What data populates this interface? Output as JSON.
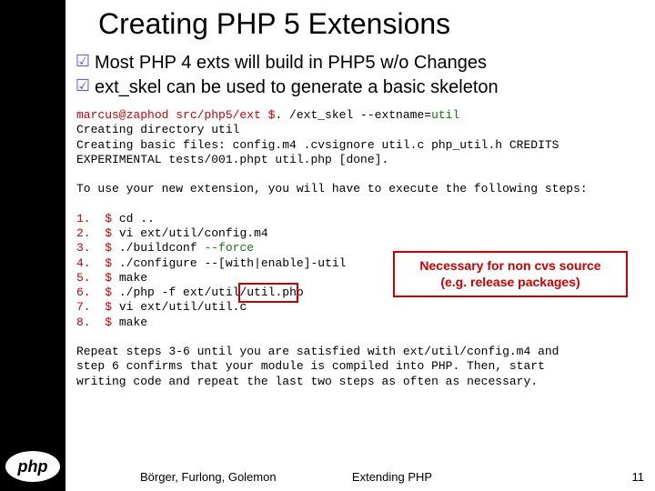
{
  "title": "Creating PHP 5 Extensions",
  "bullets": [
    "Most PHP 4 exts will build in PHP5 w/o Changes",
    "ext_skel can be used to generate a basic skeleton"
  ],
  "code1_prefix": "marcus@zaphod src/php5/ext $",
  "code1_cmd": ". /ext_skel --extname=",
  "code1_arg": "util",
  "code2": "Creating directory util\nCreating basic files: config.m4 .cvsignore util.c php_util.h CREDITS\nEXPERIMENTAL tests/001.phpt util.php [done].",
  "code3": "To use your new extension, you will have to execute the following steps:",
  "steps_nums": [
    "1.",
    "2.",
    "3.",
    "4.",
    "5.",
    "6.",
    "7.",
    "8."
  ],
  "steps_ps": [
    "$",
    "$",
    "$",
    "$",
    "$",
    "$",
    "$",
    "$"
  ],
  "steps_cmds": [
    "cd ..",
    "vi ext/util/config.m4",
    "./buildconf ",
    "./configure --[with|enable]-util",
    "make",
    "./php -f ext/util/util.php",
    "vi ext/util/util.c",
    "make"
  ],
  "step3_flag": "--force",
  "code5": "Repeat steps 3-6 until you are satisfied with ext/util/config.m4 and\nstep 6 confirms that your module is compiled into PHP. Then, start\nwriting code and repeat the last two steps as often as necessary.",
  "callout_l1": "Necessary for non cvs source",
  "callout_l2": "(e.g. release packages)",
  "footer_left": "Börger, Furlong, Golemon",
  "footer_center": "Extending PHP",
  "footer_right": "11",
  "logo": "php"
}
